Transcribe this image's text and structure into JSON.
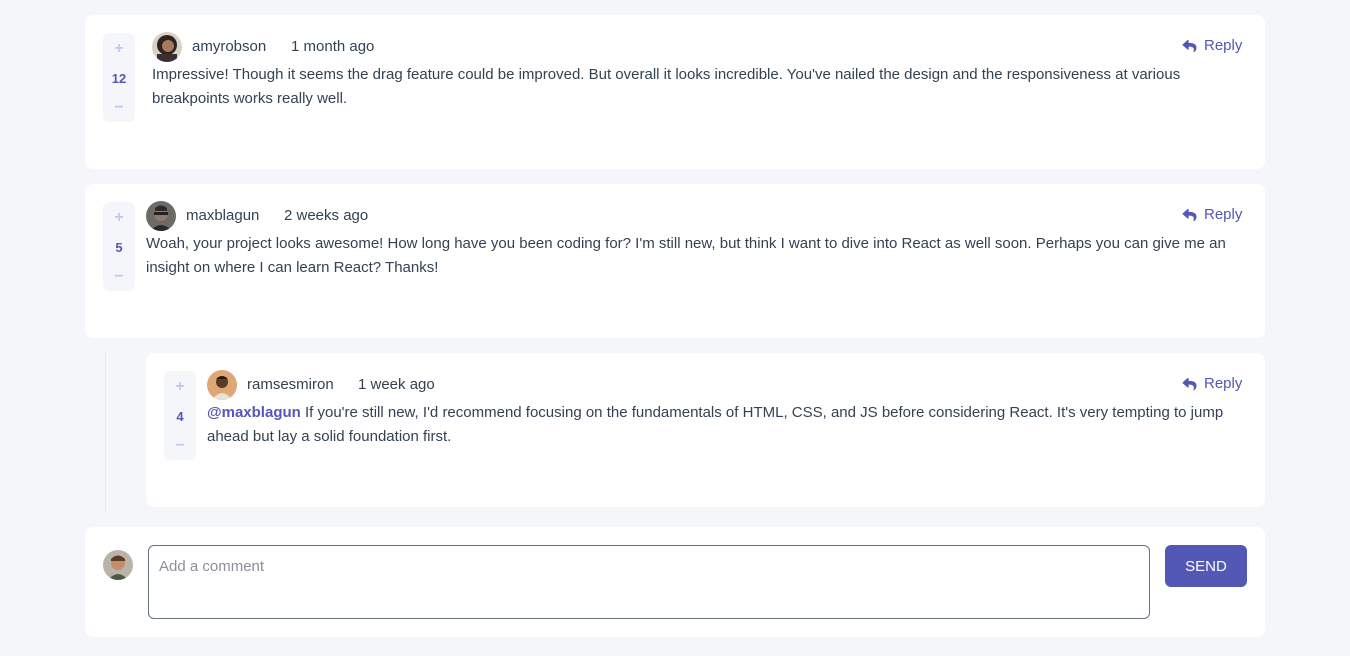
{
  "colors": {
    "accent": "#5357b6",
    "vote_icon": "#c5c6ef",
    "background": "#f5f6fa",
    "text": "#334253"
  },
  "comments": [
    {
      "score": "12",
      "username": "amyrobson",
      "created": "1 month ago",
      "reply_label": "Reply",
      "text": "Impressive! Though it seems the drag feature could be improved. But overall it looks incredible. You've nailed the design and the responsiveness at various breakpoints works really well."
    },
    {
      "score": "5",
      "username": "maxblagun",
      "created": "2 weeks ago",
      "reply_label": "Reply",
      "text": "Woah, your project looks awesome! How long have you been coding for? I'm still new, but think I want to dive into React as well soon. Perhaps you can give me an insight on where I can learn React? Thanks!"
    }
  ],
  "replies": [
    {
      "score": "4",
      "username": "ramsesmiron",
      "created": "1 week ago",
      "reply_label": "Reply",
      "mention": "@maxblagun",
      "text": "If you're still new, I'd recommend focusing on the fundamentals of HTML, CSS, and JS before considering React. It's very tempting to jump ahead but lay a solid foundation first."
    }
  ],
  "vote": {
    "plus": "+",
    "minus": "−"
  },
  "composer": {
    "placeholder": "Add a comment",
    "send_label": "SEND"
  },
  "icons": {
    "reply": "reply-icon",
    "avatar": "avatar"
  }
}
